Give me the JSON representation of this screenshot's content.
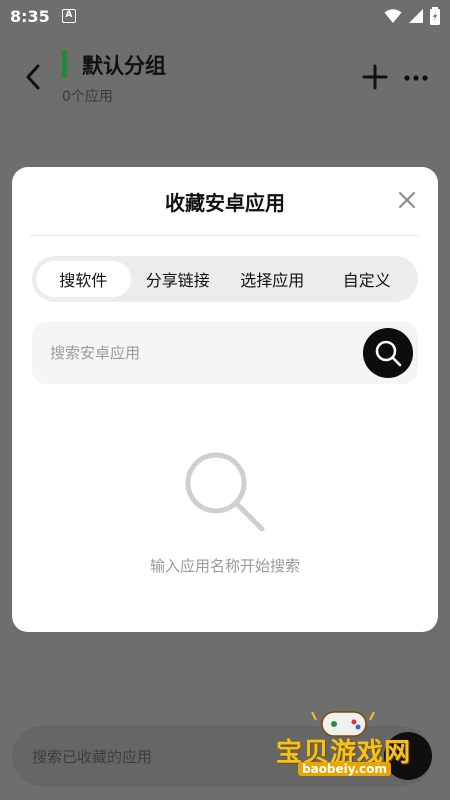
{
  "status_bar": {
    "time": "8:35",
    "app_icon_letter": "A"
  },
  "header": {
    "title": "默认分组",
    "subtitle": "0个应用",
    "accent_color": "#1f8a3a"
  },
  "modal": {
    "title": "收藏安卓应用",
    "tabs": [
      {
        "label": "搜软件",
        "active": true
      },
      {
        "label": "分享链接",
        "active": false
      },
      {
        "label": "选择应用",
        "active": false
      },
      {
        "label": "自定义",
        "active": false
      }
    ],
    "search": {
      "placeholder": "搜索安卓应用",
      "value": ""
    },
    "empty_state": {
      "text": "输入应用名称开始搜索"
    }
  },
  "bottom_search": {
    "placeholder": "搜索已收藏的应用"
  },
  "watermark": {
    "title": "宝贝游戏网",
    "site": "baobeiy.com"
  },
  "icons": {
    "back": "chevron-left-icon",
    "add": "plus-icon",
    "more": "more-icon",
    "close": "close-icon",
    "search": "search-icon"
  }
}
